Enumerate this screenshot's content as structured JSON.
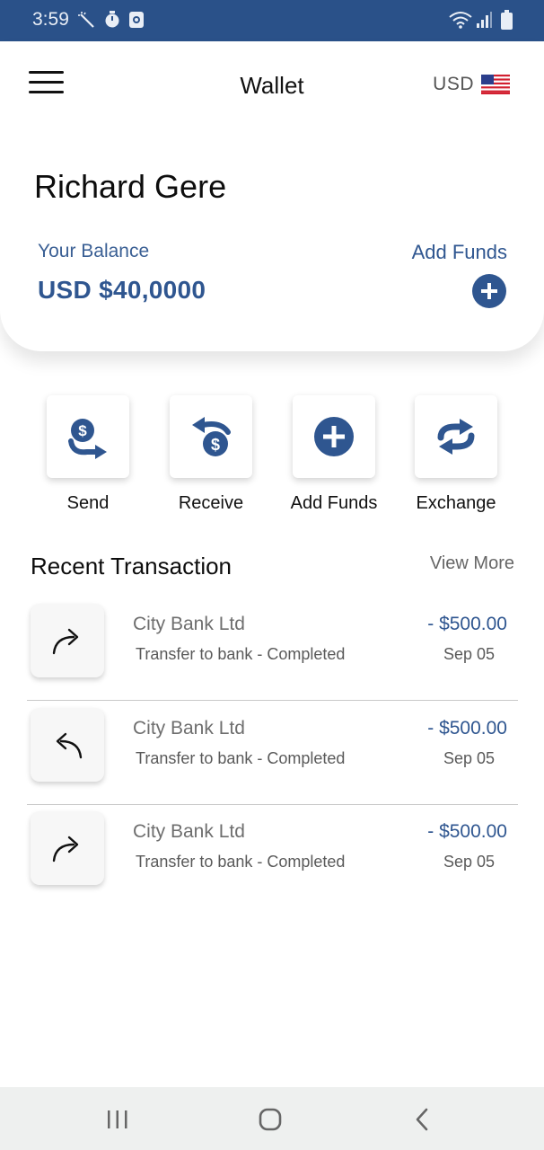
{
  "status_bar": {
    "time": "3:59",
    "bg_color": "#2a5189",
    "left_icons": [
      "magic-wand-icon",
      "stopwatch-icon",
      "screen-record-icon"
    ],
    "right_icons": [
      "wifi-icon",
      "signal-icon",
      "battery-icon"
    ]
  },
  "header": {
    "title": "Wallet",
    "currency_code": "USD",
    "currency_flag": "us-flag-icon",
    "menu_icon": "hamburger-menu-icon"
  },
  "account": {
    "user_name": "Richard Gere",
    "balance_label": "Your Balance",
    "balance_value": "USD $40,0000",
    "add_funds_label": "Add Funds",
    "add_funds_icon": "plus-circle-icon"
  },
  "actions": [
    {
      "label": "Send",
      "icon": "send-money-icon"
    },
    {
      "label": "Receive",
      "icon": "receive-money-icon"
    },
    {
      "label": "Add Funds",
      "icon": "plus-circle-icon"
    },
    {
      "label": "Exchange",
      "icon": "exchange-icon"
    }
  ],
  "transactions_section": {
    "title": "Recent Transaction",
    "view_more": "View More",
    "items": [
      {
        "name": "City Bank Ltd",
        "description": "Transfer to bank - Completed",
        "amount": "- $500.00",
        "date": "Sep 05",
        "icon": "arrow-forward-icon"
      },
      {
        "name": "City Bank Ltd",
        "description": "Transfer to bank - Completed",
        "amount": "- $500.00",
        "date": "Sep 05",
        "icon": "arrow-back-icon"
      },
      {
        "name": "City Bank Ltd",
        "description": "Transfer to bank - Completed",
        "amount": "- $500.00",
        "date": "Sep 05",
        "icon": "arrow-forward-icon"
      }
    ]
  },
  "nav_bar": {
    "buttons": [
      "recent-apps-icon",
      "home-icon",
      "back-icon"
    ]
  },
  "colors": {
    "primary": "#2f5690",
    "status_bar": "#2a5189",
    "nav_bar": "#eef0ef"
  }
}
